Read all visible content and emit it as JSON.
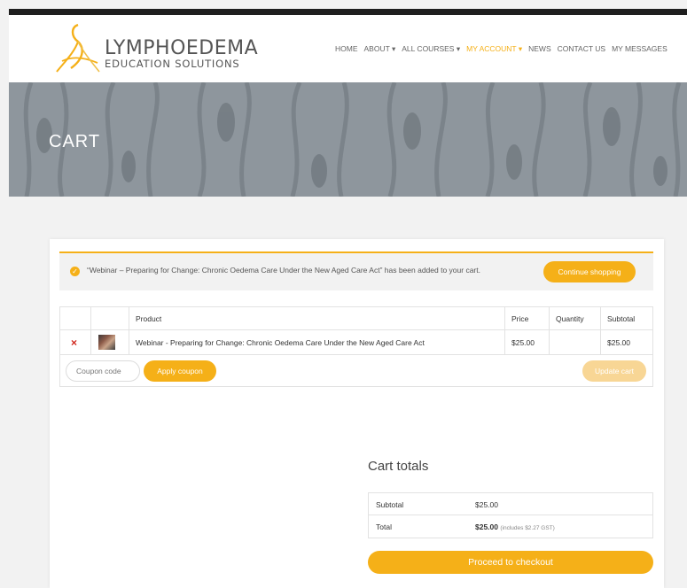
{
  "brand": {
    "name_line1": "LYMPHOEDEMA",
    "name_line2": "EDUCATION SOLUTIONS",
    "accent_color": "#f5b018"
  },
  "nav": {
    "items": [
      {
        "label": "HOME"
      },
      {
        "label": "ABOUT ▾"
      },
      {
        "label": "ALL COURSES ▾"
      },
      {
        "label": "MY ACCOUNT ▾",
        "active": true
      },
      {
        "label": "NEWS"
      },
      {
        "label": "CONTACT US"
      },
      {
        "label": "MY MESSAGES"
      }
    ]
  },
  "hero": {
    "title": "CART"
  },
  "notice": {
    "message": "“Webinar – Preparing for Change: Chronic Oedema Care Under the New Aged Care Act” has been added to your cart.",
    "button": "Continue shopping"
  },
  "cart": {
    "headers": {
      "product": "Product",
      "price": "Price",
      "quantity": "Quantity",
      "subtotal": "Subtotal"
    },
    "items": [
      {
        "remove": "×",
        "product": "Webinar - Preparing for Change: Chronic Oedema Care Under the New Aged Care Act",
        "price": "$25.00",
        "quantity": "",
        "subtotal": "$25.00"
      }
    ],
    "coupon_placeholder": "Coupon code",
    "apply_coupon": "Apply coupon",
    "update_cart": "Update cart"
  },
  "totals": {
    "title": "Cart totals",
    "subtotal_label": "Subtotal",
    "subtotal_value": "$25.00",
    "total_label": "Total",
    "total_value": "$25.00",
    "total_note": "(includes $2.27 GST)",
    "checkout": "Proceed to checkout"
  }
}
